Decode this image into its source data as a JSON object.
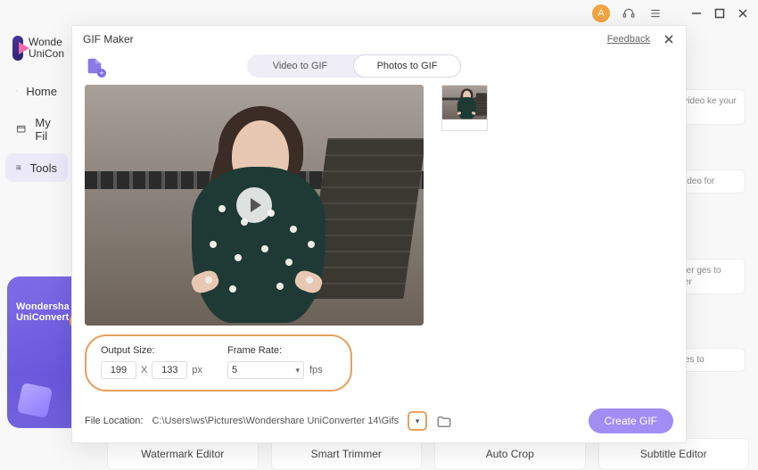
{
  "window": {
    "avatar_initial": "A"
  },
  "app": {
    "brand_line1": "Wonde",
    "brand_line2": "UniCon"
  },
  "sidebar": {
    "items": [
      {
        "label": "Home"
      },
      {
        "label": "My Fil"
      },
      {
        "label": "Tools"
      }
    ]
  },
  "promo": {
    "line1": "Wondersha",
    "line2": "UniConvert"
  },
  "teasers": {
    "t1": "se video ke your out.",
    "t2": "D video for",
    "t3": "verter ges to other",
    "t4": "y files to"
  },
  "tool_row": {
    "items": [
      {
        "label": "Watermark Editor"
      },
      {
        "label": "Smart Trimmer"
      },
      {
        "label": "Auto Crop"
      },
      {
        "label": "Subtitle Editor"
      }
    ]
  },
  "modal": {
    "title": "GIF Maker",
    "feedback": "Feedback",
    "tabs": {
      "video": "Video to GIF",
      "photos": "Photos to GIF"
    },
    "settings": {
      "output_size_label": "Output Size:",
      "width": "199",
      "sep": "X",
      "height": "133",
      "px": "px",
      "frame_rate_label": "Frame Rate:",
      "frame_rate_value": "5",
      "fps": "fps"
    },
    "location": {
      "label": "File Location:",
      "path": "C:\\Users\\ws\\Pictures\\Wondershare UniConverter 14\\Gifs"
    },
    "create_button": "Create GIF"
  }
}
